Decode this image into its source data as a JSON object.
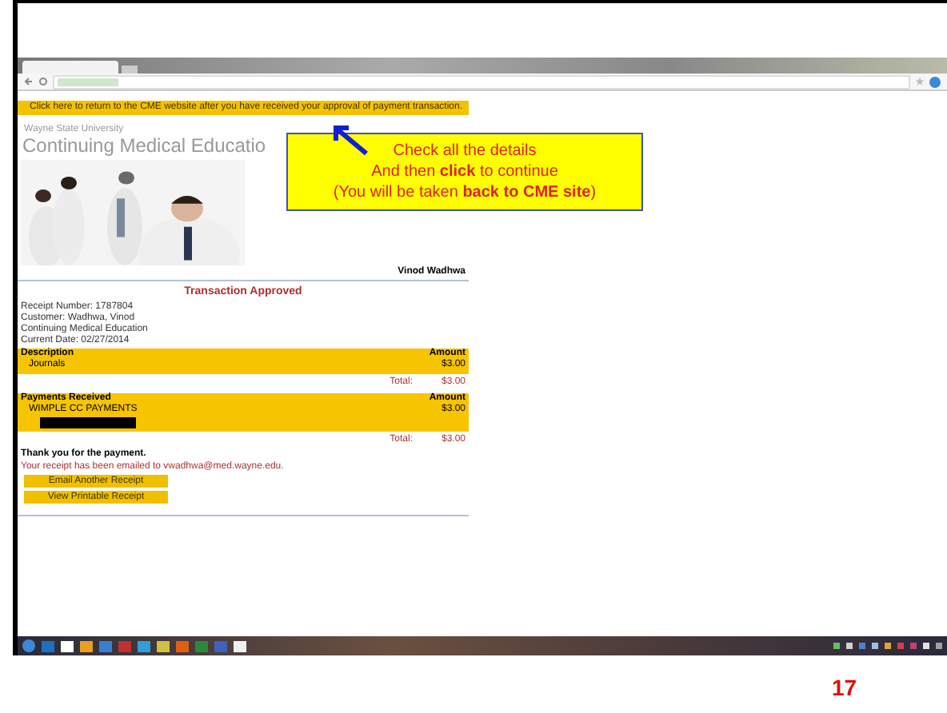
{
  "banner": {
    "text": "Click here to return to the CME website after you have received your approval of payment transaction."
  },
  "header": {
    "university": "Wayne State University",
    "title": "Continuing Medical Educatio",
    "user": "Vinod Wadhwa"
  },
  "callout": {
    "lines": [
      "Check all the details",
      "And then **click** to continue",
      "(You will be taken **back to CME site**)"
    ]
  },
  "receipt": {
    "heading": "Transaction Approved",
    "info": [
      "Receipt Number: 1787804",
      "Customer: Wadhwa, Vinod",
      "Continuing Medical Education",
      "Current Date: 02/27/2014"
    ]
  },
  "tables": [
    {
      "columns": [
        "Description",
        "Amount"
      ],
      "rows": [
        {
          "description": "Journals",
          "amount": "$3.00",
          "redacted": false
        }
      ],
      "total_label": "Total:",
      "total": "$3.00"
    },
    {
      "columns": [
        "Payments Received",
        "Amount"
      ],
      "rows": [
        {
          "description": "WIMPLE CC PAYMENTS",
          "amount": "$3.00",
          "redacted": true
        }
      ],
      "total_label": "Total:",
      "total": "$3.00"
    }
  ],
  "thanks": "Thank you for the payment.",
  "email_note": "Your receipt has been emailed to vwadhwa@med.wayne.edu.",
  "buttons": [
    "Email Another Receipt",
    "View Printable Receipt"
  ],
  "slide_number": "17"
}
